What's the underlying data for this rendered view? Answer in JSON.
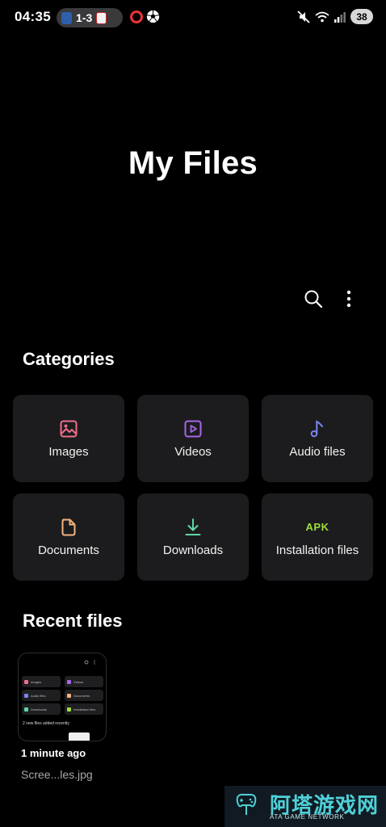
{
  "status_bar": {
    "time": "04:35",
    "score": "1-3",
    "battery": "38"
  },
  "header": {
    "title": "My Files"
  },
  "categories": {
    "title": "Categories",
    "items": [
      {
        "label": "Images",
        "icon": "image-icon",
        "color": "#f06e8c"
      },
      {
        "label": "Videos",
        "icon": "video-icon",
        "color": "#a667e6"
      },
      {
        "label": "Audio files",
        "icon": "music-note-icon",
        "color": "#7b86f0"
      },
      {
        "label": "Documents",
        "icon": "document-icon",
        "color": "#f3b27d"
      },
      {
        "label": "Downloads",
        "icon": "download-icon",
        "color": "#5fd6a4"
      },
      {
        "label": "Installation files",
        "icon": "apk-icon",
        "icon_text": "APK",
        "color": "#9fdc3c"
      }
    ]
  },
  "recent": {
    "title": "Recent files",
    "files": [
      {
        "time": "1 minute ago",
        "name": "Scree...les.jpg",
        "thumbnail": {
          "labels": [
            "Images",
            "Videos",
            "Audio files",
            "Documents",
            "Downloads",
            "Installation files"
          ],
          "note": "2 new files added recently"
        }
      }
    ]
  },
  "watermark": {
    "cn_text": "阿塔游戏网",
    "en_text": "ATA GAME NETWORK"
  }
}
